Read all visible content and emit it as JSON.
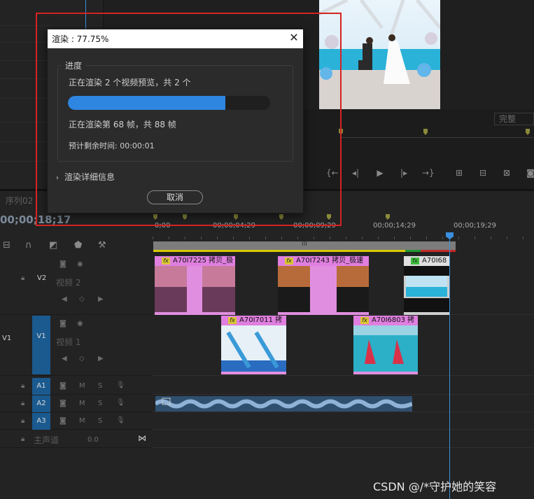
{
  "dialog": {
    "title": "渲染 : 77.75%",
    "group_label": "进度",
    "line1": "正在渲染 2 个视频预览，共 2 个",
    "progress": 0.7775,
    "line2": "正在渲染第 68 帧，共 88 帧",
    "time_remaining": "预计剩余时间: 00:00:01",
    "details_label": "渲染详细信息",
    "cancel_label": "取消"
  },
  "monitor": {
    "fit_label": "完整"
  },
  "sequence": {
    "tab": "序列02",
    "timecode": "00;00;18;17",
    "ruler_labels": [
      "0;00",
      "00;00;04;29",
      "00;00;09;29",
      "00;00;14;29",
      "00;00;19;29"
    ]
  },
  "tracks": {
    "v2": {
      "id": "V2",
      "label": "视频 2"
    },
    "v1_src": "V1",
    "v1": {
      "id": "V1",
      "label": "视频 1"
    },
    "a1": "A1",
    "a2": "A2",
    "a3": "A3",
    "master_label": "主声道",
    "master_value": "0.0",
    "m": "M",
    "s": "S"
  },
  "clips": {
    "v2": [
      {
        "name": "A70I7225 拷贝_极"
      },
      {
        "name": "A70I7243 拷贝_极速"
      },
      {
        "name": "A70I68"
      }
    ],
    "v1": [
      {
        "name": "A70I7011 拷"
      },
      {
        "name": "A70I6803 拷"
      }
    ],
    "fx": "fx"
  },
  "watermark": "CSDN @/*守护她的笑容",
  "colors": {
    "accent": "#2e86e0",
    "clip": "#e08fe0",
    "highlight": "#d42323",
    "track_selected": "#1a5a8f"
  }
}
